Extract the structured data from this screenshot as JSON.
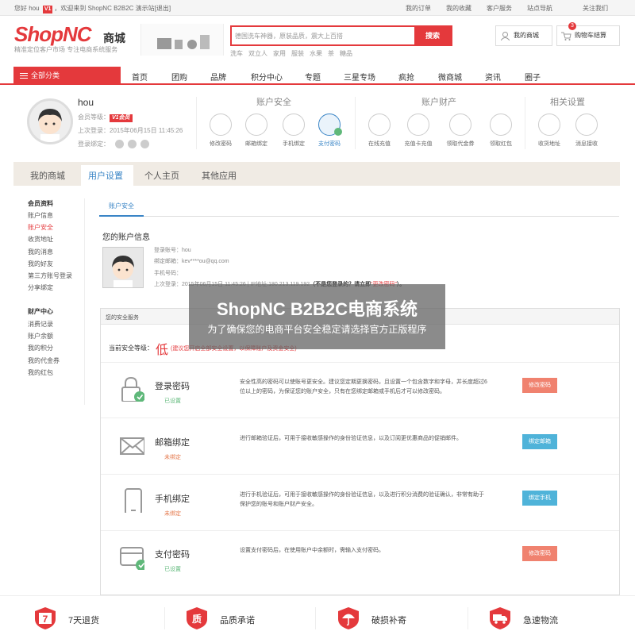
{
  "topbar": {
    "greeting": "您好",
    "username": "hou",
    "vip": "V1",
    "welcome": "，欢迎来到 ShopNC B2B2C 演示站",
    "logout": "[退出]",
    "links": [
      "我的订单",
      "我的收藏",
      "客户服务",
      "站点导航",
      "关注我们"
    ]
  },
  "header": {
    "logo": "ShopNC",
    "logo_sub": "商城",
    "tagline": "精准定位客户市场  专注电商系统服务",
    "search_placeholder": "德国洗车神器，原装品质，震大上百搭",
    "search_button": "搜索",
    "hotwords": [
      "洗车",
      "双立人",
      "家用",
      "服装",
      "水果",
      "茶",
      "糖品"
    ],
    "my_store": "我的商城",
    "cart": "购物车结算",
    "cart_count": "3"
  },
  "nav": {
    "all_categories": "全部分类",
    "items": [
      "首页",
      "团购",
      "品牌",
      "积分中心",
      "专题",
      "三星专场",
      "疯抢",
      "微商城",
      "资讯",
      "圈子"
    ]
  },
  "profile": {
    "name": "hou",
    "level_label": "会员等级：",
    "level_badge": "V1会员",
    "last_login": "上次登录：2015年06月15日 11:45:26",
    "binding_label": "登录绑定：",
    "groups": [
      {
        "title": "账户安全",
        "items": [
          "修改密码",
          "邮箱绑定",
          "手机绑定",
          "支付密码"
        ]
      },
      {
        "title": "账户财产",
        "items": [
          "在线充值",
          "充值卡充值",
          "领取代金券",
          "领取红包"
        ]
      },
      {
        "title": "相关设置",
        "items": [
          "收货地址",
          "消息接收"
        ]
      }
    ]
  },
  "tabs": [
    "我的商城",
    "用户设置",
    "个人主页",
    "其他应用"
  ],
  "sidebar": {
    "section1_title": "会员资料",
    "section1_items": [
      "账户信息",
      "账户安全",
      "收货地址",
      "我的消息",
      "我的好友",
      "第三方账号登录",
      "分享绑定"
    ],
    "section2_title": "财产中心",
    "section2_items": [
      "消费记录",
      "账户余额",
      "我的积分",
      "我的代金券",
      "我的红包"
    ]
  },
  "main": {
    "subtab": "账户安全",
    "account_title": "您的账户信息",
    "login_account": "登录账号：hou",
    "bound_email": "绑定邮箱：kev****ou@qq.com",
    "phone": "手机号码：",
    "last_login_prefix": "上次登录：2015年06月15日 11:45:26  |  IP地址:180.213.119.192",
    "not_you": "（不是您登录的？请立即",
    "change_password_link": "“更改密码”",
    "not_you_end": "）。",
    "security_header": "您的安全服务",
    "level_prefix": "当前安全等级：",
    "level_value": "低",
    "level_tip": "(建议您开启全部安全设置，以保障账户及资金安全)",
    "rows": [
      {
        "name": "登录密码",
        "status": "已设置",
        "desc": "安全性高的密码可以使账号更安全。建议您定期更换密码，且设置一个包含数字和字母，并长度超过6位以上的密码，为保证您的账户安全，只有在您绑定邮箱或手机后才可以修改密码。",
        "button": "修改密码"
      },
      {
        "name": "邮箱绑定",
        "status": "未绑定",
        "desc": "进行邮箱验证后，可用于接收敏感操作的身份验证信息，以及订阅更优惠商品的促销邮件。",
        "button": "绑定邮箱"
      },
      {
        "name": "手机绑定",
        "status": "未绑定",
        "desc": "进行手机验证后，可用于接收敏感操作的身份验证信息，以及进行积分消费的验证确认，非常有助于保护您的账号和账户财产安全。",
        "button": "绑定手机"
      },
      {
        "name": "支付密码",
        "status": "已设置",
        "desc": "设置支付密码后，在使用账户中余额时，需输入支付密码。",
        "button": "修改密码"
      }
    ]
  },
  "watermark": {
    "title": "ShopNC B2B2C电商系统",
    "subtitle": "为了确保您的电商平台安全稳定请选择官方正版程序"
  },
  "footer": {
    "items": [
      "7天退货",
      "品质承诺",
      "破损补寄",
      "急速物流"
    ],
    "badges": [
      "7",
      "质",
      "",
      ""
    ]
  },
  "colors": {
    "accent": "#e4393c",
    "blue": "#3a85c6",
    "ok": "#5fb87a",
    "warn": "#e47a4e"
  }
}
